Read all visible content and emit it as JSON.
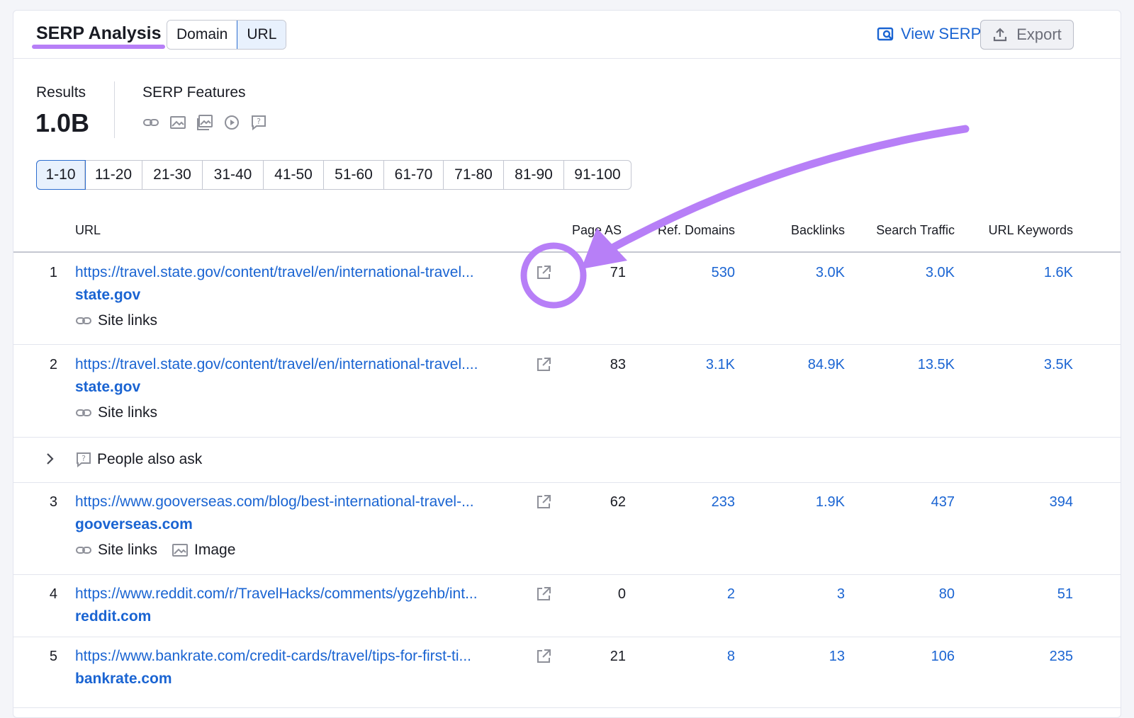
{
  "header": {
    "title": "SERP Analysis",
    "toggle": [
      {
        "label": "Domain",
        "active": false
      },
      {
        "label": "URL",
        "active": true
      }
    ],
    "view_serp": "View SERP",
    "export": "Export"
  },
  "summary": {
    "results_label": "Results",
    "results_value": "1.0B",
    "features_label": "SERP Features",
    "features_icons": [
      "link-icon",
      "image-icon",
      "image-pack-icon",
      "video-icon",
      "question-icon"
    ]
  },
  "pagination": [
    "1-10",
    "11-20",
    "21-30",
    "31-40",
    "41-50",
    "51-60",
    "61-70",
    "71-80",
    "81-90",
    "91-100"
  ],
  "table": {
    "columns": {
      "url": "URL",
      "page_as": "Page AS",
      "ref_domains": "Ref. Domains",
      "backlinks": "Backlinks",
      "search_traffic": "Search Traffic",
      "url_keywords": "URL Keywords"
    },
    "rows": [
      {
        "num": "1",
        "url": "https://travel.state.gov/content/travel/en/international-travel...",
        "domain": "state.gov",
        "tags": [
          "Site links"
        ],
        "page_as": "71",
        "ref_domains": "530",
        "backlinks": "3.0K",
        "search_traffic": "3.0K",
        "url_keywords": "1.6K"
      },
      {
        "num": "2",
        "url": "https://travel.state.gov/content/travel/en/international-travel....",
        "domain": "state.gov",
        "tags": [
          "Site links"
        ],
        "page_as": "83",
        "ref_domains": "3.1K",
        "backlinks": "84.9K",
        "search_traffic": "13.5K",
        "url_keywords": "3.5K"
      },
      {
        "num": "3",
        "url": "https://www.gooverseas.com/blog/best-international-travel-...",
        "domain": "gooverseas.com",
        "tags": [
          "Site links",
          "Image"
        ],
        "page_as": "62",
        "ref_domains": "233",
        "backlinks": "1.9K",
        "search_traffic": "437",
        "url_keywords": "394"
      },
      {
        "num": "4",
        "url": "https://www.reddit.com/r/TravelHacks/comments/ygzehb/int...",
        "domain": "reddit.com",
        "tags": [],
        "page_as": "0",
        "ref_domains": "2",
        "backlinks": "3",
        "search_traffic": "80",
        "url_keywords": "51"
      },
      {
        "num": "5",
        "url": "https://www.bankrate.com/credit-cards/travel/tips-for-first-ti...",
        "domain": "bankrate.com",
        "tags": [],
        "page_as": "21",
        "ref_domains": "8",
        "backlinks": "13",
        "search_traffic": "106",
        "url_keywords": "235"
      }
    ],
    "people_also_ask": "People also ask"
  },
  "colors": {
    "accent": "#1a64d2",
    "annotation": "#b77ff7"
  }
}
